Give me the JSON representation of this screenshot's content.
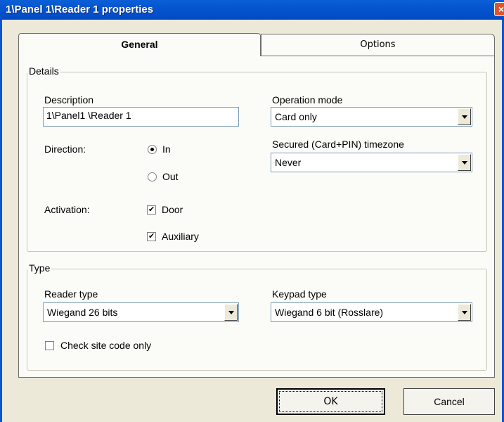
{
  "window": {
    "title": "1\\Panel 1\\Reader 1 properties",
    "close_glyph": "×"
  },
  "tabs": [
    {
      "label": "General",
      "active": true
    },
    {
      "label": "Options",
      "active": false
    }
  ],
  "details": {
    "legend": "Details",
    "description_label": "Description",
    "description_value": "1\\Panel1 \\Reader 1",
    "direction_label": "Direction:",
    "direction_in": "In",
    "direction_out": "Out",
    "direction_selected": "In",
    "activation_label": "Activation:",
    "door_label": "Door",
    "door_checked": true,
    "auxiliary_label": "Auxiliary",
    "auxiliary_checked": true,
    "operation_mode_label": "Operation mode",
    "operation_mode_value": "Card only",
    "secured_label": "Secured (Card+PIN)  timezone",
    "secured_value": "Never"
  },
  "type": {
    "legend": "Type",
    "reader_type_label": "Reader type",
    "reader_type_value": "Wiegand 26 bits",
    "keypad_type_label": "Keypad type",
    "keypad_type_value": "Wiegand 6 bit (Rosslare)",
    "check_site_label": "Check site code only",
    "check_site_checked": false
  },
  "buttons": {
    "ok": "OK",
    "cancel": "Cancel"
  },
  "colors": {
    "titlebar": "#0455d0",
    "dialog_bg": "#ece9d8",
    "panel_bg": "#fbfbf8"
  }
}
